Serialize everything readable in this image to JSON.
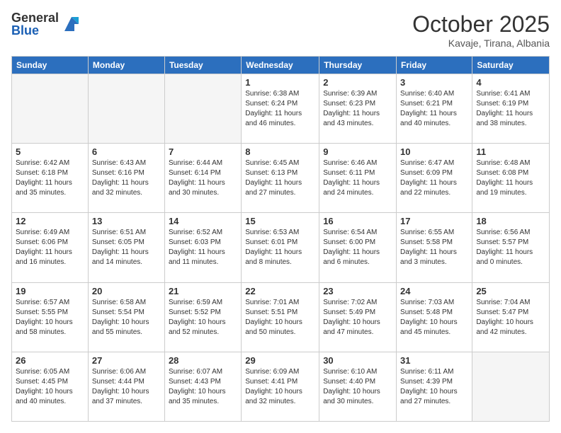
{
  "logo": {
    "general": "General",
    "blue": "Blue"
  },
  "header": {
    "month": "October 2025",
    "location": "Kavaje, Tirana, Albania"
  },
  "weekdays": [
    "Sunday",
    "Monday",
    "Tuesday",
    "Wednesday",
    "Thursday",
    "Friday",
    "Saturday"
  ],
  "weeks": [
    [
      {
        "day": "",
        "info": ""
      },
      {
        "day": "",
        "info": ""
      },
      {
        "day": "",
        "info": ""
      },
      {
        "day": "1",
        "info": "Sunrise: 6:38 AM\nSunset: 6:24 PM\nDaylight: 11 hours\nand 46 minutes."
      },
      {
        "day": "2",
        "info": "Sunrise: 6:39 AM\nSunset: 6:23 PM\nDaylight: 11 hours\nand 43 minutes."
      },
      {
        "day": "3",
        "info": "Sunrise: 6:40 AM\nSunset: 6:21 PM\nDaylight: 11 hours\nand 40 minutes."
      },
      {
        "day": "4",
        "info": "Sunrise: 6:41 AM\nSunset: 6:19 PM\nDaylight: 11 hours\nand 38 minutes."
      }
    ],
    [
      {
        "day": "5",
        "info": "Sunrise: 6:42 AM\nSunset: 6:18 PM\nDaylight: 11 hours\nand 35 minutes."
      },
      {
        "day": "6",
        "info": "Sunrise: 6:43 AM\nSunset: 6:16 PM\nDaylight: 11 hours\nand 32 minutes."
      },
      {
        "day": "7",
        "info": "Sunrise: 6:44 AM\nSunset: 6:14 PM\nDaylight: 11 hours\nand 30 minutes."
      },
      {
        "day": "8",
        "info": "Sunrise: 6:45 AM\nSunset: 6:13 PM\nDaylight: 11 hours\nand 27 minutes."
      },
      {
        "day": "9",
        "info": "Sunrise: 6:46 AM\nSunset: 6:11 PM\nDaylight: 11 hours\nand 24 minutes."
      },
      {
        "day": "10",
        "info": "Sunrise: 6:47 AM\nSunset: 6:09 PM\nDaylight: 11 hours\nand 22 minutes."
      },
      {
        "day": "11",
        "info": "Sunrise: 6:48 AM\nSunset: 6:08 PM\nDaylight: 11 hours\nand 19 minutes."
      }
    ],
    [
      {
        "day": "12",
        "info": "Sunrise: 6:49 AM\nSunset: 6:06 PM\nDaylight: 11 hours\nand 16 minutes."
      },
      {
        "day": "13",
        "info": "Sunrise: 6:51 AM\nSunset: 6:05 PM\nDaylight: 11 hours\nand 14 minutes."
      },
      {
        "day": "14",
        "info": "Sunrise: 6:52 AM\nSunset: 6:03 PM\nDaylight: 11 hours\nand 11 minutes."
      },
      {
        "day": "15",
        "info": "Sunrise: 6:53 AM\nSunset: 6:01 PM\nDaylight: 11 hours\nand 8 minutes."
      },
      {
        "day": "16",
        "info": "Sunrise: 6:54 AM\nSunset: 6:00 PM\nDaylight: 11 hours\nand 6 minutes."
      },
      {
        "day": "17",
        "info": "Sunrise: 6:55 AM\nSunset: 5:58 PM\nDaylight: 11 hours\nand 3 minutes."
      },
      {
        "day": "18",
        "info": "Sunrise: 6:56 AM\nSunset: 5:57 PM\nDaylight: 11 hours\nand 0 minutes."
      }
    ],
    [
      {
        "day": "19",
        "info": "Sunrise: 6:57 AM\nSunset: 5:55 PM\nDaylight: 10 hours\nand 58 minutes."
      },
      {
        "day": "20",
        "info": "Sunrise: 6:58 AM\nSunset: 5:54 PM\nDaylight: 10 hours\nand 55 minutes."
      },
      {
        "day": "21",
        "info": "Sunrise: 6:59 AM\nSunset: 5:52 PM\nDaylight: 10 hours\nand 52 minutes."
      },
      {
        "day": "22",
        "info": "Sunrise: 7:01 AM\nSunset: 5:51 PM\nDaylight: 10 hours\nand 50 minutes."
      },
      {
        "day": "23",
        "info": "Sunrise: 7:02 AM\nSunset: 5:49 PM\nDaylight: 10 hours\nand 47 minutes."
      },
      {
        "day": "24",
        "info": "Sunrise: 7:03 AM\nSunset: 5:48 PM\nDaylight: 10 hours\nand 45 minutes."
      },
      {
        "day": "25",
        "info": "Sunrise: 7:04 AM\nSunset: 5:47 PM\nDaylight: 10 hours\nand 42 minutes."
      }
    ],
    [
      {
        "day": "26",
        "info": "Sunrise: 6:05 AM\nSunset: 4:45 PM\nDaylight: 10 hours\nand 40 minutes."
      },
      {
        "day": "27",
        "info": "Sunrise: 6:06 AM\nSunset: 4:44 PM\nDaylight: 10 hours\nand 37 minutes."
      },
      {
        "day": "28",
        "info": "Sunrise: 6:07 AM\nSunset: 4:43 PM\nDaylight: 10 hours\nand 35 minutes."
      },
      {
        "day": "29",
        "info": "Sunrise: 6:09 AM\nSunset: 4:41 PM\nDaylight: 10 hours\nand 32 minutes."
      },
      {
        "day": "30",
        "info": "Sunrise: 6:10 AM\nSunset: 4:40 PM\nDaylight: 10 hours\nand 30 minutes."
      },
      {
        "day": "31",
        "info": "Sunrise: 6:11 AM\nSunset: 4:39 PM\nDaylight: 10 hours\nand 27 minutes."
      },
      {
        "day": "",
        "info": ""
      }
    ]
  ]
}
